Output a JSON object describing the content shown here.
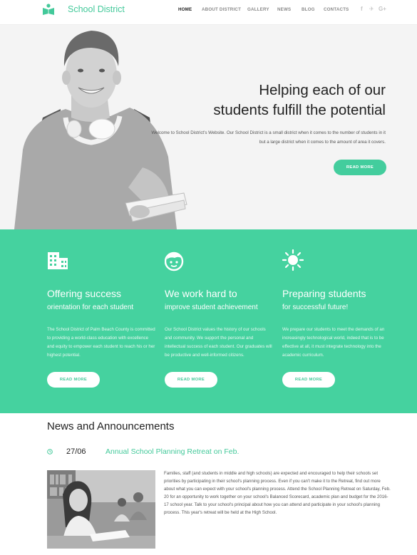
{
  "header": {
    "logo_icon": "open-book-icon",
    "logo_text": "School District",
    "nav": [
      "HOME",
      "ABOUT DISTRICT",
      "GALLERY",
      "NEWS",
      "BLOG",
      "CONTACTS"
    ],
    "social": {
      "facebook": "f",
      "twitter": "✈",
      "google": "G+"
    }
  },
  "hero": {
    "title_line1": "Helping each of our",
    "title_line2": "students fulfill the potential",
    "description": "Welcome to School District's Website. Our School District is a small district when it comes to the number of students in it but a large district when it comes to the amount of area it covers.",
    "button": "READ MORE"
  },
  "features": [
    {
      "icon": "building-icon",
      "title": "Offering success",
      "subtitle": "orientation for each student",
      "text": "The School District of Palm Beach County is committed to providing a world-class education with excellence and equity to empower each student to reach his or her highest potential.",
      "button": "READ MORE"
    },
    {
      "icon": "smiley-face-icon",
      "title": "We work hard to",
      "subtitle": "improve student achievement",
      "text": "Our School District values the history of our schools and community. We support the personal and intellectual success of each student. Our graduates will be productive and well-informed citizens.",
      "button": "READ MORE"
    },
    {
      "icon": "sun-icon",
      "title": "Preparing students",
      "subtitle": "for successful future!",
      "text": "We prepare our students to meet the demands of an increasingly technological world, indeed that is to be effective at all, it must integrate technology into the academic curriculum.",
      "button": "READ MORE"
    }
  ],
  "news": {
    "heading": "News and Announcements",
    "item": {
      "date": "27/06",
      "title": "Annual School Planning Retreat on Feb.",
      "text": "Families, staff (and students in middle and high schools) are expected and encouraged to help their schools set priorities by participating in their school's planning process. Even if you can't make it to the Retreat, find out more about what you can expect with your school's planning process. Attend the School Planning Retreat on Saturday, Feb. 20 for an opportunity to work together on your school's Balanced Scorecard, academic plan and budget for the 2016-17 school year. Talk to your school's principal about how you can attend and participate in your school's planning process. This year's retreat will be held at the High School."
    }
  },
  "colors": {
    "accent": "#45d29f",
    "accent_text": "#43c99a",
    "hero_bg": "#f4f4f4",
    "dark_text": "#222222"
  }
}
